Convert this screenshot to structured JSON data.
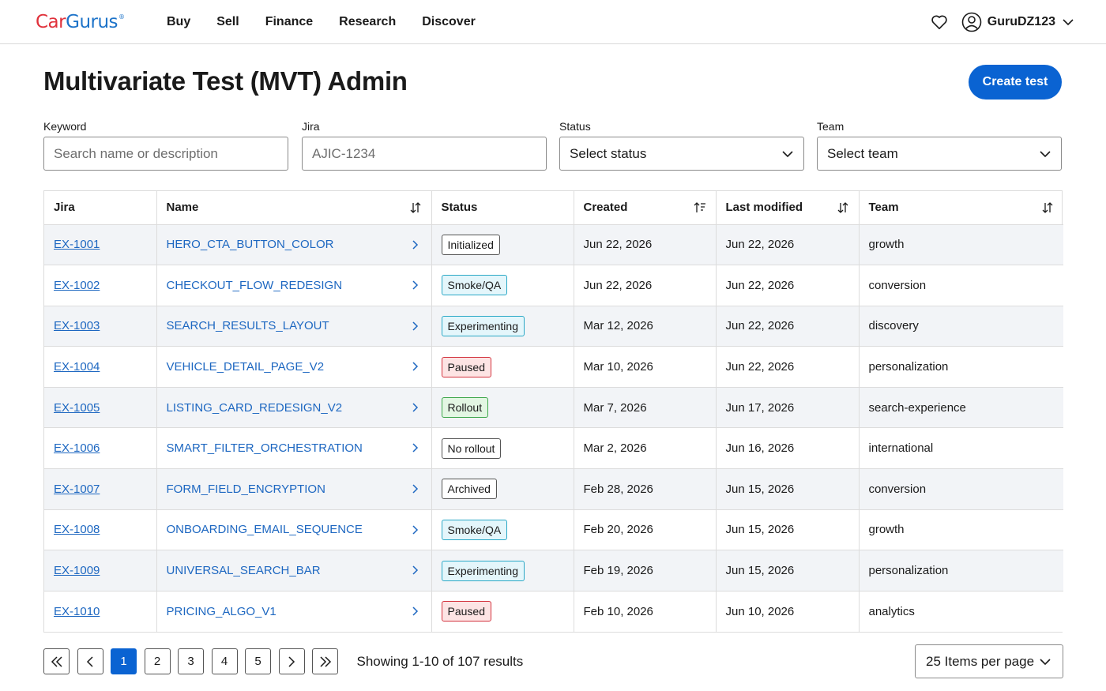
{
  "brand": {
    "part1": "Car",
    "part2": "Gurus",
    "reg": "®",
    "color_red": "#e0313b",
    "color_blue": "#1d73c9"
  },
  "nav": {
    "items": [
      {
        "label": "Buy"
      },
      {
        "label": "Sell"
      },
      {
        "label": "Finance"
      },
      {
        "label": "Research"
      },
      {
        "label": "Discover"
      }
    ]
  },
  "user": {
    "name": "GuruDZ123"
  },
  "page": {
    "title": "Multivariate Test (MVT) Admin",
    "create_label": "Create test",
    "accent": "#0a63d2"
  },
  "filters": {
    "keyword": {
      "label": "Keyword",
      "placeholder": "Search name or description",
      "value": ""
    },
    "jira": {
      "label": "Jira",
      "placeholder": "AJIC-1234",
      "value": ""
    },
    "status": {
      "label": "Status",
      "selected": "Select status"
    },
    "team": {
      "label": "Team",
      "selected": "Select team"
    }
  },
  "table": {
    "headers": {
      "jira": "Jira",
      "name": "Name",
      "status": "Status",
      "created": "Created",
      "modified": "Last modified",
      "team": "Team"
    },
    "rows": [
      {
        "jira": "EX-1001",
        "name": "HERO_CTA_BUTTON_COLOR",
        "status": "Initialized",
        "status_kind": "neutral",
        "created": "Jun 22, 2026",
        "modified": "Jun 22, 2026",
        "team": "growth"
      },
      {
        "jira": "EX-1002",
        "name": "CHECKOUT_FLOW_REDESIGN",
        "status": "Smoke/QA",
        "status_kind": "smoke",
        "created": "Jun 22, 2026",
        "modified": "Jun 22, 2026",
        "team": "conversion"
      },
      {
        "jira": "EX-1003",
        "name": "SEARCH_RESULTS_LAYOUT",
        "status": "Experimenting",
        "status_kind": "exp",
        "created": "Mar 12, 2026",
        "modified": "Jun 22, 2026",
        "team": "discovery"
      },
      {
        "jira": "EX-1004",
        "name": "VEHICLE_DETAIL_PAGE_V2",
        "status": "Paused",
        "status_kind": "paused",
        "created": "Mar 10, 2026",
        "modified": "Jun 22, 2026",
        "team": "personalization"
      },
      {
        "jira": "EX-1005",
        "name": "LISTING_CARD_REDESIGN_V2",
        "status": "Rollout",
        "status_kind": "rollout",
        "created": "Mar 7, 2026",
        "modified": "Jun 17, 2026",
        "team": "search-experience"
      },
      {
        "jira": "EX-1006",
        "name": "SMART_FILTER_ORCHESTRATION",
        "status": "No rollout",
        "status_kind": "neutral",
        "created": "Mar 2, 2026",
        "modified": "Jun 16, 2026",
        "team": "international"
      },
      {
        "jira": "EX-1007",
        "name": "FORM_FIELD_ENCRYPTION",
        "status": "Archived",
        "status_kind": "neutral",
        "created": "Feb 28, 2026",
        "modified": "Jun 15, 2026",
        "team": "conversion"
      },
      {
        "jira": "EX-1008",
        "name": "ONBOARDING_EMAIL_SEQUENCE",
        "status": "Smoke/QA",
        "status_kind": "smoke",
        "created": "Feb 20, 2026",
        "modified": "Jun 15, 2026",
        "team": "growth"
      },
      {
        "jira": "EX-1009",
        "name": "UNIVERSAL_SEARCH_BAR",
        "status": "Experimenting",
        "status_kind": "exp",
        "created": "Feb 19, 2026",
        "modified": "Jun 15, 2026",
        "team": "personalization"
      },
      {
        "jira": "EX-1010",
        "name": "PRICING_ALGO_V1",
        "status": "Paused",
        "status_kind": "paused",
        "created": "Feb 10, 2026",
        "modified": "Jun 10, 2026",
        "team": "analytics"
      }
    ]
  },
  "pagination": {
    "pages": [
      "1",
      "2",
      "3",
      "4",
      "5"
    ],
    "current": "1",
    "showing": "Showing 1-10 of 107 results",
    "per_page": "25 Items per page"
  }
}
